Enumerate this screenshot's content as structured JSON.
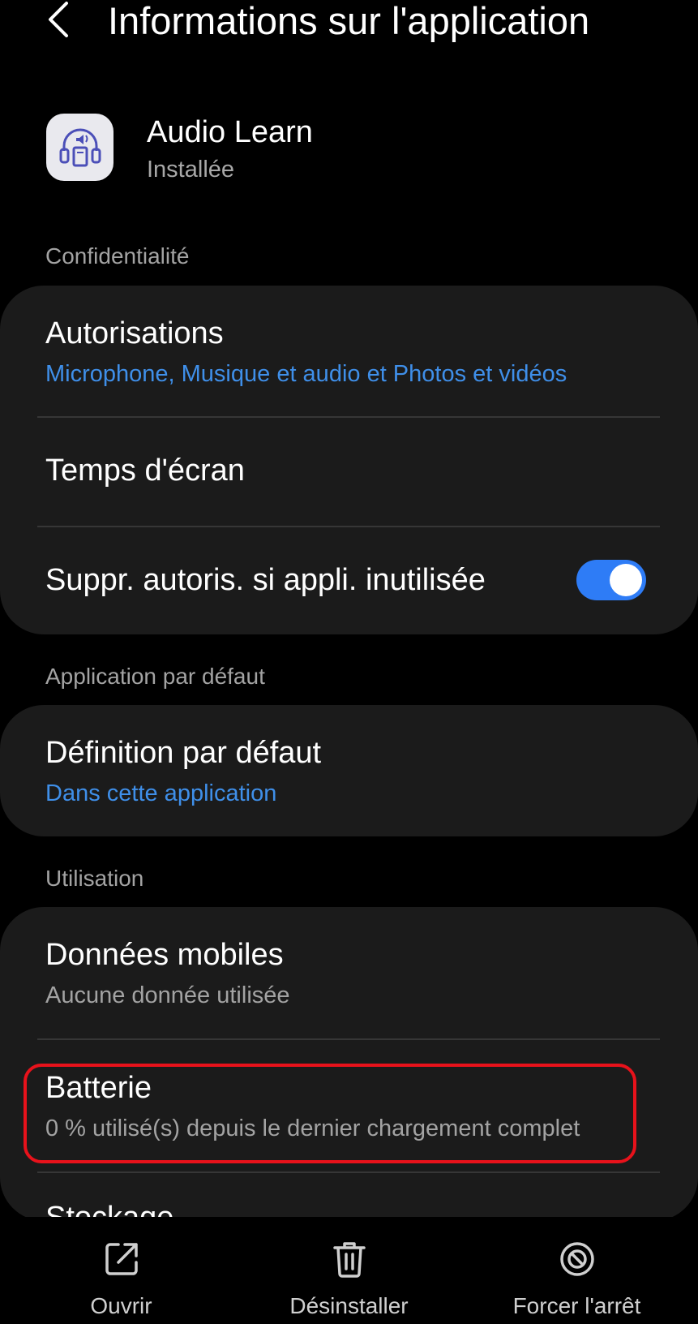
{
  "header": {
    "title": "Informations sur l'application"
  },
  "app": {
    "name": "Audio Learn",
    "status": "Installée"
  },
  "sections": {
    "privacy": "Confidentialité",
    "default_app": "Application par défaut",
    "usage": "Utilisation"
  },
  "privacy": {
    "permissions_title": "Autorisations",
    "permissions_value": "Microphone, Musique et audio et Photos et vidéos",
    "screen_time_title": "Temps d'écran",
    "remove_perms_title": "Suppr. autoris. si appli. inutilisée",
    "remove_perms_enabled": true
  },
  "default_app": {
    "title": "Définition par défaut",
    "value": "Dans cette application"
  },
  "usage": {
    "mobile_data_title": "Données mobiles",
    "mobile_data_value": "Aucune donnée utilisée",
    "battery_title": "Batterie",
    "battery_value": "0 % utilisé(s) depuis le dernier chargement complet",
    "storage_title": "Stockage"
  },
  "actions": {
    "open": "Ouvrir",
    "uninstall": "Désinstaller",
    "force_stop": "Forcer l'arrêt"
  },
  "colors": {
    "accent_blue": "#3f8fe9",
    "toggle_on": "#2e7cf6",
    "highlight_red": "#e8121b",
    "card_bg": "#1b1b1b"
  }
}
